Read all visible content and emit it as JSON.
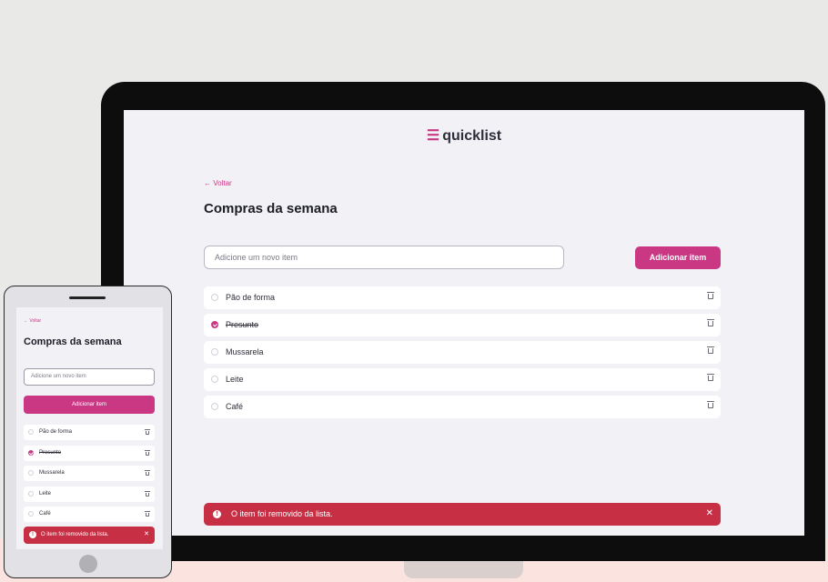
{
  "app": {
    "logo_text": "quicklist",
    "logo_mark": "☰",
    "brand_color": "#ca3884",
    "error_color": "#c72f44"
  },
  "page": {
    "back_label": "← Voltar",
    "title": "Compras da semana"
  },
  "form": {
    "placeholder": "Adicione um novo item",
    "add_label": "Adicionar item"
  },
  "items": [
    {
      "label": "Pão de forma",
      "checked": false
    },
    {
      "label": "Presunto",
      "checked": true
    },
    {
      "label": "Mussarela",
      "checked": false
    },
    {
      "label": "Leite",
      "checked": false
    },
    {
      "label": "Café",
      "checked": false
    }
  ],
  "toast": {
    "icon": "alert-icon",
    "icon_glyph": "!",
    "message": "O item foi removido da lista.",
    "close_glyph": "✕"
  }
}
